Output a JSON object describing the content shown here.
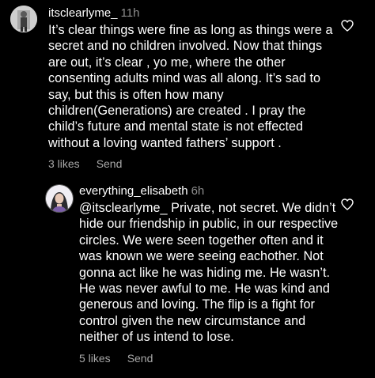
{
  "comments": [
    {
      "username": "itsclearlyme_",
      "time": "11h",
      "text": "It’s clear things were fine as long as things were a secret and no children involved. Now that things are out, it’s clear , yo me, where the other consenting adults mind was all along. It’s sad to say, but this is often how many children(Generations) are created . I pray the child’s future and mental state is not effected without a loving wanted fathers’ support .",
      "likes": "3 likes",
      "send": "Send",
      "like_icon": "heart-outline-icon"
    },
    {
      "username": "everything_elisabeth",
      "time": "6h",
      "text": "@itsclearlyme_ Private, not secret. We didn’t hide our friendship in public, in our respective circles. We were seen together often and it was known we were seeing eachother. Not gonna act like he was hiding me. He wasn’t. He was never awful to me. He was kind and generous and loving. The flip is a fight for control given the new circumstance and neither of us intend to lose.",
      "likes": "5 likes",
      "send": "Send",
      "like_icon": "heart-outline-icon"
    }
  ],
  "colors": {
    "background": "#000000",
    "text": "#ffffff",
    "muted": "#8e8e8e",
    "actions": "#a8a8a8"
  }
}
